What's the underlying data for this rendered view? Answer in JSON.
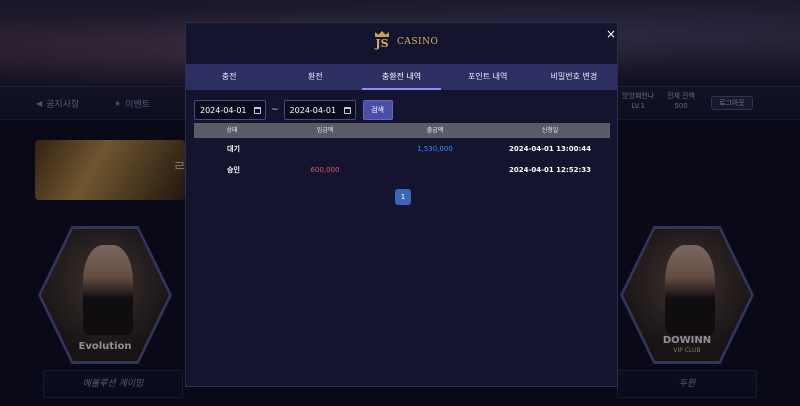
{
  "background": {
    "nav": {
      "items": [
        {
          "label": "공지사항",
          "icon": "speaker-icon"
        },
        {
          "label": "이벤트",
          "icon": "star-icon"
        }
      ],
      "user": {
        "name": "앙앙퍠천나",
        "level": "LV.1"
      },
      "balance": {
        "label": "전체 잔액",
        "value": "500"
      },
      "logout_label": "로그아웃"
    },
    "banner_text": "ㄹ",
    "games": [
      {
        "brand": "Evolution",
        "sub": ""
      },
      {
        "brand": "DOWINN",
        "sub": "VIP CLUB"
      }
    ],
    "game_buttons": [
      "에볼루션 게이밍",
      "두윈"
    ]
  },
  "modal": {
    "logo": {
      "mark": "JS",
      "text": "CASINO"
    },
    "close_label": "×",
    "tabs": [
      {
        "label": "충전",
        "active": false
      },
      {
        "label": "환전",
        "active": false
      },
      {
        "label": "충환전 내역",
        "active": true
      },
      {
        "label": "포인트 내역",
        "active": false
      },
      {
        "label": "비밀번호 변경",
        "active": false
      }
    ],
    "filter": {
      "start_date": "2024-04-01",
      "separator": "~",
      "end_date": "2024-04-01",
      "search_label": "검색"
    },
    "table": {
      "headers": [
        "상태",
        "입금액",
        "출금액",
        "신청일"
      ],
      "rows": [
        {
          "status": "대기",
          "deposit": "",
          "withdraw": "1,530,000",
          "date": "2024-04-01 13:00:44"
        },
        {
          "status": "승인",
          "deposit": "600,000",
          "withdraw": "",
          "date": "2024-04-01 12:52:33"
        }
      ]
    },
    "pagination": {
      "current": "1"
    }
  },
  "colors": {
    "accent": "#2d2f63",
    "deposit": "#e0546a",
    "withdraw": "#3b8cff",
    "gold": "#d5b062"
  }
}
